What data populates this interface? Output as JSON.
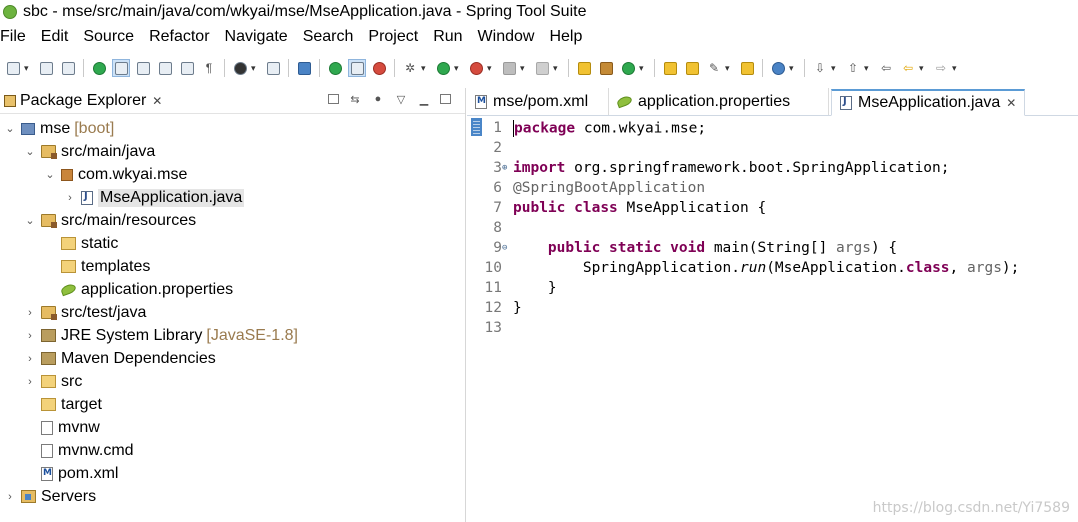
{
  "window": {
    "title": "sbc - mse/src/main/java/com/wkyai/mse/MseApplication.java - Spring Tool Suite"
  },
  "menu": [
    "File",
    "Edit",
    "Source",
    "Refactor",
    "Navigate",
    "Search",
    "Project",
    "Run",
    "Window",
    "Help"
  ],
  "package_explorer": {
    "title": "Package Explorer",
    "close": "✕",
    "tree": [
      {
        "label": "mse",
        "decor": "[boot]",
        "icon": "project-icon",
        "depth": 0,
        "chevron": "⌄",
        "selected": false
      },
      {
        "label": "src/main/java",
        "decor": "",
        "icon": "source-folder-icon",
        "depth": 1,
        "chevron": "⌄",
        "selected": false
      },
      {
        "label": "com.wkyai.mse",
        "decor": "",
        "icon": "package-icon",
        "depth": 2,
        "chevron": "⌄",
        "selected": false
      },
      {
        "label": "MseApplication.java",
        "decor": "",
        "icon": "java-file-icon",
        "depth": 3,
        "chevron": "›",
        "selected": true
      },
      {
        "label": "src/main/resources",
        "decor": "",
        "icon": "source-folder-icon",
        "depth": 1,
        "chevron": "⌄",
        "selected": false
      },
      {
        "label": "static",
        "decor": "",
        "icon": "folder-icon",
        "depth": 2,
        "chevron": "",
        "selected": false
      },
      {
        "label": "templates",
        "decor": "",
        "icon": "folder-icon",
        "depth": 2,
        "chevron": "",
        "selected": false
      },
      {
        "label": "application.properties",
        "decor": "",
        "icon": "properties-file-icon",
        "depth": 2,
        "chevron": "",
        "selected": false
      },
      {
        "label": "src/test/java",
        "decor": "",
        "icon": "source-folder-icon",
        "depth": 1,
        "chevron": "›",
        "selected": false
      },
      {
        "label": "JRE System Library",
        "decor": "[JavaSE-1.8]",
        "icon": "library-icon",
        "depth": 1,
        "chevron": "›",
        "selected": false
      },
      {
        "label": "Maven Dependencies",
        "decor": "",
        "icon": "library-icon",
        "depth": 1,
        "chevron": "›",
        "selected": false
      },
      {
        "label": "src",
        "decor": "",
        "icon": "folder-icon",
        "depth": 1,
        "chevron": "›",
        "selected": false
      },
      {
        "label": "target",
        "decor": "",
        "icon": "folder-icon",
        "depth": 1,
        "chevron": "",
        "selected": false
      },
      {
        "label": "mvnw",
        "decor": "",
        "icon": "file-icon",
        "depth": 1,
        "chevron": "",
        "selected": false
      },
      {
        "label": "mvnw.cmd",
        "decor": "",
        "icon": "file-icon",
        "depth": 1,
        "chevron": "",
        "selected": false
      },
      {
        "label": "pom.xml",
        "decor": "",
        "icon": "maven-file-icon",
        "depth": 1,
        "chevron": "",
        "selected": false
      },
      {
        "label": "Servers",
        "decor": "",
        "icon": "servers-folder-icon",
        "depth": 0,
        "chevron": "›",
        "selected": false
      }
    ]
  },
  "editor": {
    "tabs": [
      {
        "label": "mse/pom.xml",
        "icon": "maven-file-icon",
        "active": false
      },
      {
        "label": "application.properties",
        "icon": "properties-file-icon",
        "active": false
      },
      {
        "label": "MseApplication.java",
        "icon": "java-file-icon",
        "active": true
      }
    ],
    "tab_close": "✕",
    "lines": [
      {
        "n": "1",
        "fold": "",
        "tokens": [
          {
            "t": "package",
            "c": "kw"
          },
          {
            "t": " com.wkyai.mse;",
            "c": ""
          }
        ]
      },
      {
        "n": "2",
        "fold": "",
        "tokens": []
      },
      {
        "n": "3",
        "fold": "⊕",
        "tokens": [
          {
            "t": "import",
            "c": "kw"
          },
          {
            "t": " org.springframework.boot.SpringApplication;",
            "c": ""
          }
        ]
      },
      {
        "n": "6",
        "fold": "",
        "tokens": [
          {
            "t": "@SpringBootApplication",
            "c": "ann"
          }
        ]
      },
      {
        "n": "7",
        "fold": "",
        "tokens": [
          {
            "t": "public",
            "c": "kw"
          },
          {
            "t": " ",
            "c": ""
          },
          {
            "t": "class",
            "c": "kw"
          },
          {
            "t": " MseApplication {",
            "c": ""
          }
        ]
      },
      {
        "n": "8",
        "fold": "",
        "tokens": []
      },
      {
        "n": "9",
        "fold": "⊖",
        "tokens": [
          {
            "t": "    ",
            "c": ""
          },
          {
            "t": "public",
            "c": "kw"
          },
          {
            "t": " ",
            "c": ""
          },
          {
            "t": "static",
            "c": "kw"
          },
          {
            "t": " ",
            "c": ""
          },
          {
            "t": "void",
            "c": "kw"
          },
          {
            "t": " main(String[] ",
            "c": ""
          },
          {
            "t": "args",
            "c": "ann"
          },
          {
            "t": ") {",
            "c": ""
          }
        ]
      },
      {
        "n": "10",
        "fold": "",
        "tokens": [
          {
            "t": "        SpringApplication.",
            "c": ""
          },
          {
            "t": "run",
            "c": "it"
          },
          {
            "t": "(MseApplication.",
            "c": ""
          },
          {
            "t": "class",
            "c": "kw"
          },
          {
            "t": ", ",
            "c": ""
          },
          {
            "t": "args",
            "c": "ann"
          },
          {
            "t": ");",
            "c": ""
          }
        ]
      },
      {
        "n": "11",
        "fold": "",
        "tokens": [
          {
            "t": "    }",
            "c": ""
          }
        ]
      },
      {
        "n": "12",
        "fold": "",
        "tokens": [
          {
            "t": "}",
            "c": ""
          }
        ]
      },
      {
        "n": "13",
        "fold": "",
        "tokens": []
      }
    ]
  },
  "watermark": "https://blog.csdn.net/Yi7589"
}
